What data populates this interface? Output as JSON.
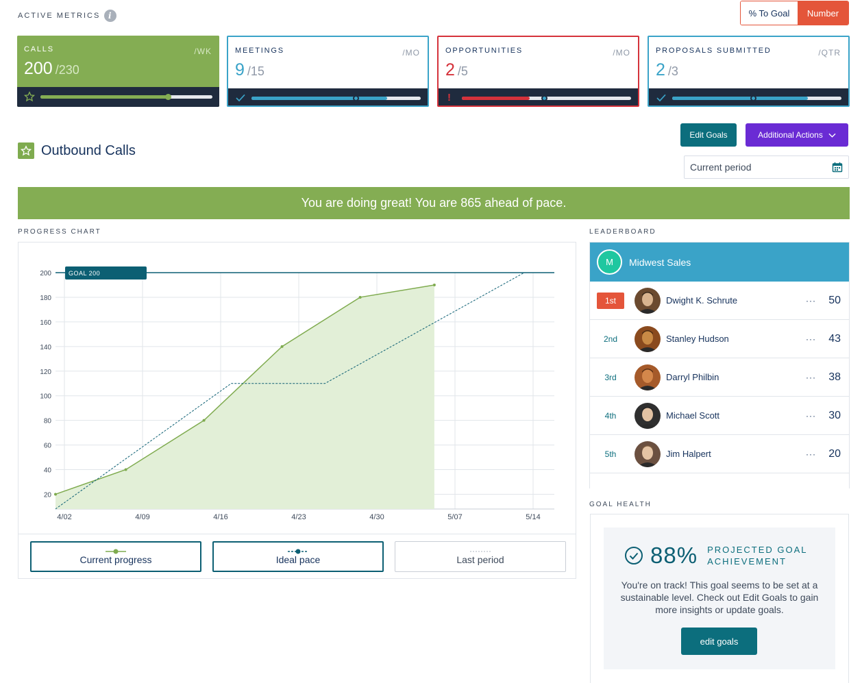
{
  "header": {
    "active_metrics_label": "ACTIVE METRICS",
    "info_glyph": "i",
    "toggle_goal": "% To Goal",
    "toggle_number": "Number"
  },
  "metrics": [
    {
      "label": "CALLS",
      "unit": "/WK",
      "value": "200",
      "goal": "/230",
      "progress": 0.74,
      "status": "star"
    },
    {
      "label": "MEETINGS",
      "unit": "/MO",
      "value": "9",
      "goal": "/15",
      "progress": 0.6,
      "pace": 0.8,
      "status": "check"
    },
    {
      "label": "OPPORTUNITIES",
      "unit": "/MO",
      "value": "2",
      "goal": "/5",
      "progress": 0.4,
      "pace": 0.47,
      "status": "alert"
    },
    {
      "label": "PROPOSALS SUBMITTED",
      "unit": "/QTR",
      "value": "2",
      "goal": "/3",
      "progress": 0.67,
      "pace": 0.8,
      "status": "check"
    }
  ],
  "section": {
    "title": "Outbound Calls",
    "edit_goals": "Edit Goals",
    "additional_actions": "Additional Actions",
    "period": "Current period"
  },
  "banner": "You are doing great! You are 865 ahead of pace.",
  "progress_chart_label": "PROGRESS CHART",
  "chart_data": {
    "type": "area",
    "x": [
      "4/02",
      "4/09",
      "4/16",
      "4/23",
      "4/30",
      "5/07",
      "5/14"
    ],
    "y_ticks": [
      20,
      40,
      60,
      80,
      100,
      120,
      140,
      160,
      180,
      200
    ],
    "ylim": [
      8,
      200
    ],
    "goal": {
      "label": "GOAL 200",
      "value": 200
    },
    "series": [
      {
        "name": "Current progress",
        "style": "solid-area",
        "points": [
          [
            0,
            20
          ],
          [
            0.9,
            40
          ],
          [
            1.9,
            80
          ],
          [
            2.9,
            140
          ],
          [
            3.9,
            180
          ],
          [
            4.85,
            190
          ]
        ]
      },
      {
        "name": "Ideal pace",
        "style": "dashed",
        "points": [
          [
            0,
            8
          ],
          [
            2.25,
            110
          ],
          [
            3.45,
            110
          ],
          [
            6,
            200
          ]
        ]
      }
    ],
    "legend": [
      "Current progress",
      "Ideal pace",
      "Last period"
    ],
    "colors": {
      "progress": "#7fab4f",
      "area": "#e2efd7",
      "ideal": "#0c5f73",
      "goal": "#0c5f73",
      "grid": "#e1e5ea"
    }
  },
  "leaderboard_label": "LEADERBOARD",
  "leaderboard": {
    "team_initial": "M",
    "team": "Midwest Sales",
    "rows": [
      {
        "rank": "1st",
        "name": "Dwight K. Schrute",
        "score": "50",
        "dots": "···"
      },
      {
        "rank": "2nd",
        "name": "Stanley Hudson",
        "score": "43",
        "dots": "···"
      },
      {
        "rank": "3rd",
        "name": "Darryl Philbin",
        "score": "38",
        "dots": "···"
      },
      {
        "rank": "4th",
        "name": "Michael Scott",
        "score": "30",
        "dots": "···"
      },
      {
        "rank": "5th",
        "name": "Jim Halpert",
        "score": "20",
        "dots": "···"
      }
    ]
  },
  "goal_health_label": "GOAL HEALTH",
  "goal_health": {
    "percent": "88%",
    "caption_line1": "PROJECTED GOAL",
    "caption_line2": "ACHIEVEMENT",
    "message": "You're on track! This goal seems to be set at a sustainable level. Check out Edit Goals to gain more insights or update goals.",
    "button": "edit goals"
  },
  "colors": {
    "green": "#84ad53",
    "blue": "#3aa3c8",
    "red": "#d5323b",
    "teal": "#0c6e7d",
    "purple": "#6a2bd4",
    "orange": "#e4553a",
    "navy": "#1f2b3e"
  }
}
